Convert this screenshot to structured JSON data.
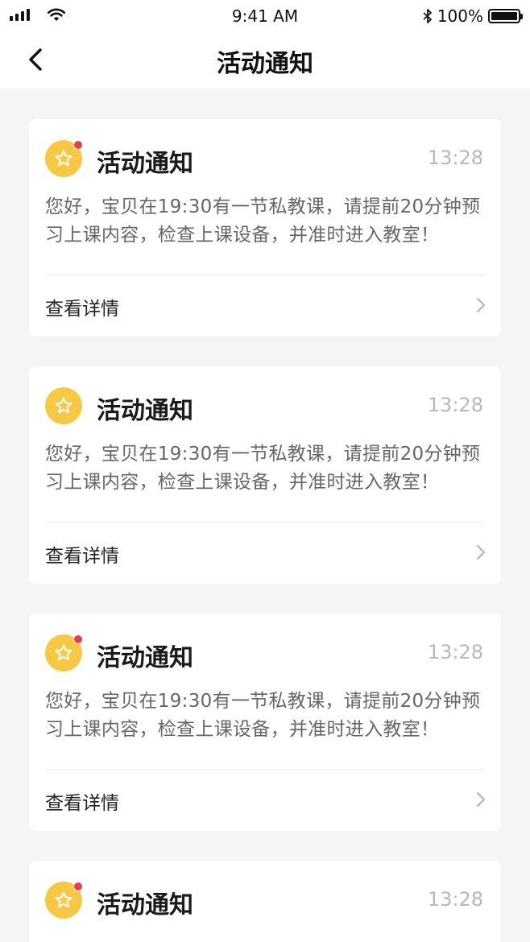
{
  "status_bar": {
    "time": "9:41 AM",
    "battery": "100%"
  },
  "nav": {
    "title": "活动通知"
  },
  "notifications": [
    {
      "title": "活动通知",
      "time": "13:28",
      "body": "您好，宝贝在19:30有一节私教课，请提前20分钟预习上课内容，检查上课设备，并准时进入教室！",
      "action": "查看详情",
      "unread": true
    },
    {
      "title": "活动通知",
      "time": "13:28",
      "body": "您好，宝贝在19:30有一节私教课，请提前20分钟预习上课内容，检查上课设备，并准时进入教室！",
      "action": "查看详情",
      "unread": false
    },
    {
      "title": "活动通知",
      "time": "13:28",
      "body": "您好，宝贝在19:30有一节私教课，请提前20分钟预习上课内容，检查上课设备，并准时进入教室！",
      "action": "查看详情",
      "unread": true
    },
    {
      "title": "活动通知",
      "time": "13:28",
      "body": "",
      "action": "",
      "unread": true
    }
  ]
}
